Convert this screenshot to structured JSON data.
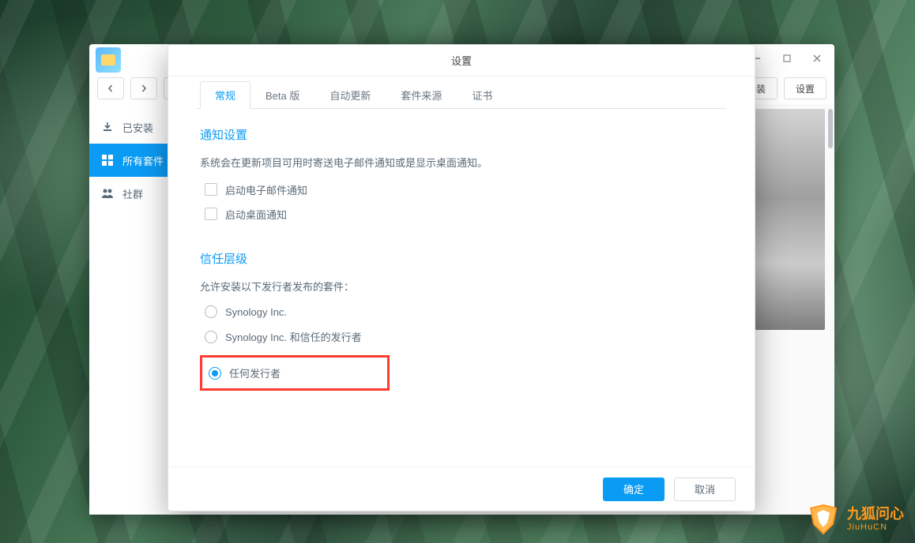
{
  "mainWindow": {
    "toolbar": {
      "manualInstall": "安装",
      "settings": "设置"
    },
    "sidebar": {
      "installed": "已安装",
      "allPackages": "所有套件",
      "community": "社群"
    }
  },
  "modal": {
    "title": "设置",
    "tabs": {
      "general": "常规",
      "beta": "Beta 版",
      "autoUpdate": "自动更新",
      "sources": "套件来源",
      "cert": "证书"
    },
    "notification": {
      "title": "通知设置",
      "desc": "系统会在更新项目可用时寄送电子邮件通知或是显示桌面通知。",
      "emailCheckbox": "启动电子邮件通知",
      "desktopCheckbox": "启动桌面通知"
    },
    "trust": {
      "title": "信任层级",
      "desc": "允许安装以下发行者发布的套件：",
      "option1": "Synology Inc.",
      "option2": "Synology Inc. 和信任的发行者",
      "option3": "任何发行者"
    },
    "footer": {
      "ok": "确定",
      "cancel": "取消"
    }
  },
  "watermark": {
    "cn": "九狐问心",
    "en": "JiuHuCN"
  }
}
